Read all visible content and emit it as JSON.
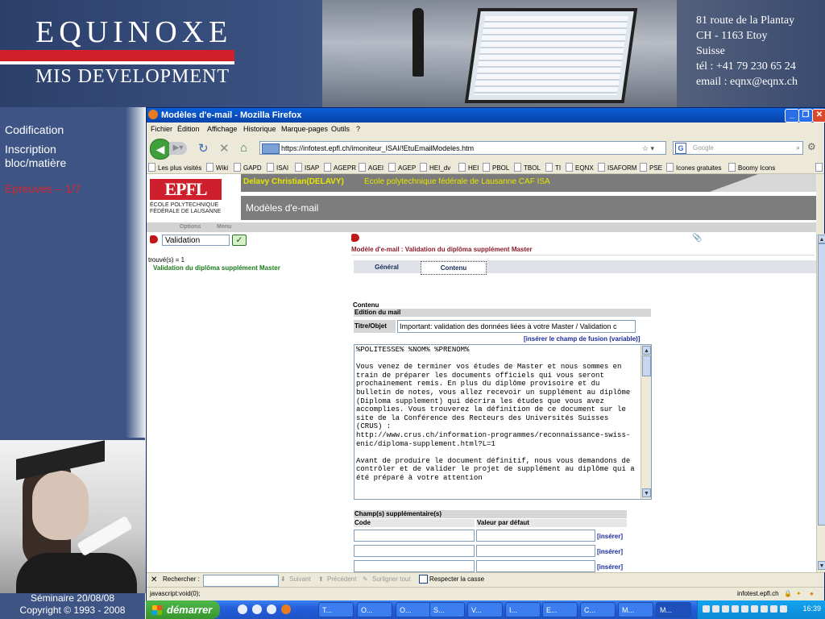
{
  "slide": {
    "brand_line1": "EQUINOXE",
    "brand_line2": "MIS DEVELOPMENT",
    "address": [
      "81 route de la Plantay",
      "CH - 1163 Etoy",
      "Suisse",
      "tél : +41 79 230 65 24",
      "email : eqnx@eqnx.ch"
    ],
    "nav": [
      {
        "label": "Codification",
        "active": false
      },
      {
        "label": "Inscription bloc/matière",
        "active": false
      },
      {
        "label": "Epreuves – 1/7",
        "active": true
      }
    ],
    "footer_line1": "Séminaire 20/08/08",
    "footer_line2": "Copyright © 1993 - 2008"
  },
  "window": {
    "title": "Modèles d'e-mail - Mozilla Firefox",
    "menu": [
      "Fichier",
      "Édition",
      "Affichage",
      "Historique",
      "Marque-pages",
      "Outils",
      "?"
    ],
    "url": "https://infotest.epfl.ch/imoniteur_ISAI/!EtuEmailModeles.htm",
    "search_placeholder": "Google",
    "bookmarks": [
      "Les plus visités",
      "Wiki",
      "GAPD",
      "ISAI",
      "ISAP",
      "AGEPR",
      "AGEI",
      "AGEP",
      "HEI_dv",
      "HEI",
      "PBOL",
      "TBOL",
      "TI",
      "EQNX",
      "ISAFORM",
      "PSE",
      "Icones gratuites",
      "Boomy Icons"
    ],
    "bookmarks_overflow": "»"
  },
  "page": {
    "logo": "EPFL",
    "logo_sub1": "ÉCOLE POLYTECHNIQUE",
    "logo_sub2": "FÉDÉRALE DE LAUSANNE",
    "user": "Delavy Christian(DELAVY)",
    "school": "Ecole polytechnique fédérale de Lausanne    CAF ISA",
    "title": "Modèles d'e-mail",
    "options": "Options",
    "menu": "Menu",
    "search_value": "Validation",
    "search_go": "✓",
    "found": "trouvé(s) = 1",
    "result": "Validation du diplôma supplément Master",
    "form_header": "Modèle d'e-mail : Validation du diplôma supplément Master",
    "tab_general": "Général",
    "tab_contenu": "Contenu",
    "section_title": "Contenu",
    "section_sub": "Edition du mail",
    "subject_label": "Titre/Objet",
    "subject_value": "Important: validation des données liées à votre Master / Validation c",
    "insert_variable": "[insérer le champ de fusion (variable)]",
    "body_text": "%POLITESSE% %NOM% %PRENOM%\n\nVous venez de terminer vos études de Master et nous sommes en train de préparer les documents officiels qui vous seront prochainement remis. En plus du diplôme provisoire et du bulletin de notes, vous allez recevoir un supplément au diplôme (Diploma supplement) qui décrira les études que vous avez accomplies. Vous trouverez la définition de ce document sur le site de la Conférence des Recteurs des Universités Suisses (CRUS) :\nhttp://www.crus.ch/information-programmes/reconnaissance-swiss-enic/diploma-supplement.html?L=1\n\nAvant de produire le document définitif, nous vous demandons de contrôler et de valider le projet de supplément au diplôme qui a été préparé à votre attention",
    "extra_fields_title": "Champ(s) supplémentaire(s)",
    "col_code": "Code",
    "col_value": "Valeur par défaut",
    "insert_label": "[insérer]"
  },
  "findbar": {
    "close": "✕",
    "label": "Rechercher :",
    "next": "Suivant",
    "prev": "Précédent",
    "highlight": "Surligner tout",
    "matchcase": "Respecter la casse"
  },
  "status": {
    "left": "javascript:void(0);",
    "right": "infotest.epfl.ch"
  },
  "taskbar": {
    "start": "démarrer",
    "tasks": [
      "T...",
      "O...",
      "O...",
      "S...",
      "V...",
      "I...",
      "E...",
      "C...",
      "M...",
      "M..."
    ],
    "clock": "16:39"
  }
}
